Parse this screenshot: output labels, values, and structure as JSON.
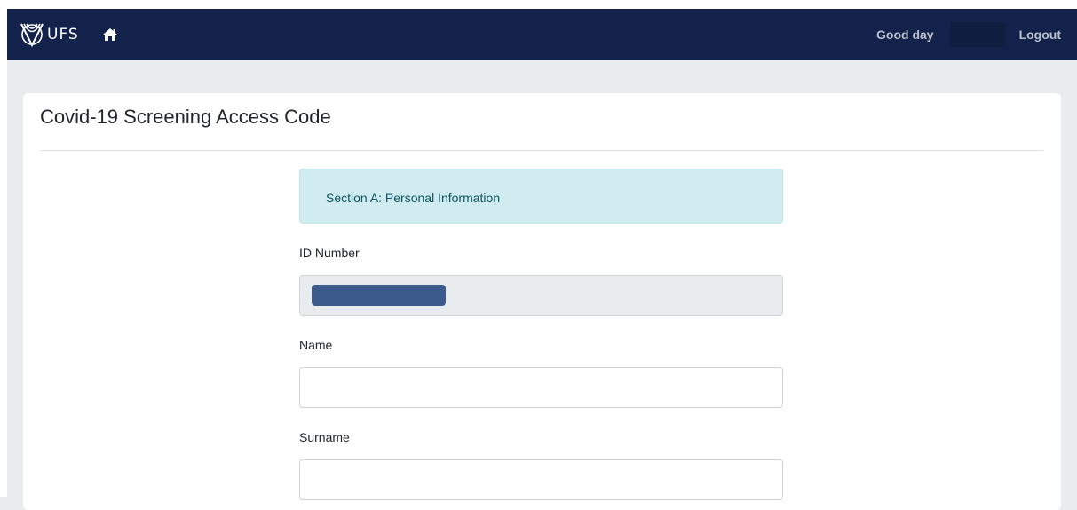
{
  "navbar": {
    "brand_text": "UFS",
    "greeting": "Good day",
    "logout_label": "Logout",
    "home_icon": "home-icon",
    "logo_icon": "ufs-shield-logo",
    "background": "#13224a"
  },
  "page": {
    "title": "Covid-19 Screening Access Code"
  },
  "form": {
    "section_title": "Section A: Personal Information",
    "fields": {
      "id_number": {
        "label": "ID Number",
        "value": ""
      },
      "name": {
        "label": "Name",
        "value": ""
      },
      "surname": {
        "label": "Surname",
        "value": ""
      }
    }
  },
  "colors": {
    "alert_bg": "#d1ecf1",
    "alert_text": "#0c5460",
    "page_bg": "#e9ecef"
  }
}
